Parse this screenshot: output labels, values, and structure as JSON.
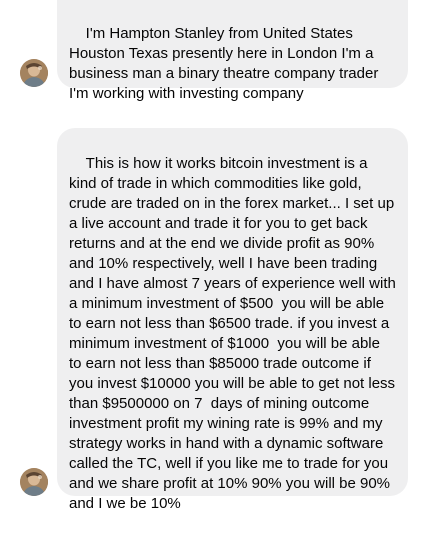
{
  "messages": [
    {
      "sender": "avatar",
      "text": "I'm Hampton Stanley from United States Houston Texas presently here in London I'm a business man a binary theatre company trader I'm working with investing company"
    },
    {
      "sender": "avatar",
      "text": "This is how it works bitcoin investment is a kind of trade in which commodities like gold, crude are traded on in the forex market... I set up a live account and trade it for you to get back returns and at the end we divide profit as 90% and 10% respectively, well I have been trading and I have almost 7 years of experience well with a minimum investment of $500  you will be able to earn not less than $6500 trade. if you invest a minimum investment of $1000  you will be able to earn not less than $85000 trade outcome if you invest $10000 you will be able to get not less than $9500000 on 7  days of mining outcome investment profit my wining rate is 99% and my strategy works in hand with a dynamic software called the TC, well if you like me to trade for you and we share profit at 10% 90% you will be 90% and I we be 10%"
    }
  ]
}
